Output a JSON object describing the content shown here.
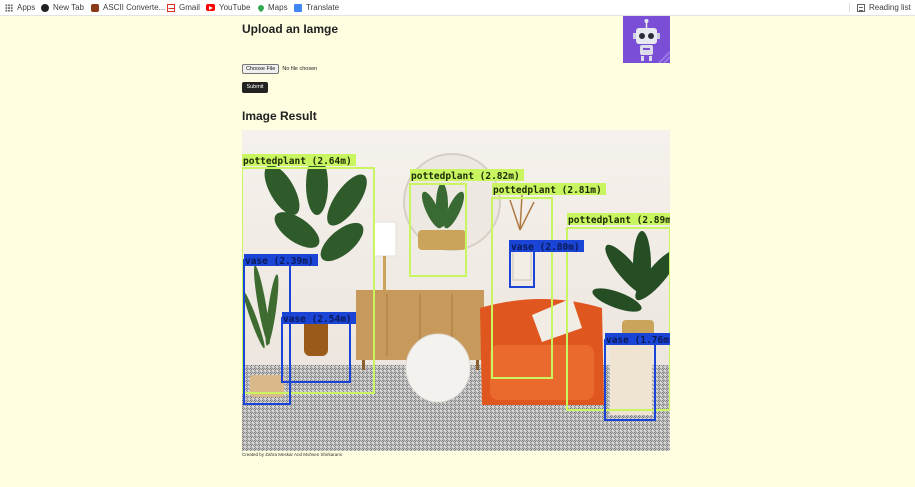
{
  "bookmarks_bar": {
    "items": [
      {
        "label": "Apps",
        "icon": "apps-grid-icon"
      },
      {
        "label": "New Tab",
        "icon": "new-tab-icon"
      },
      {
        "label": "ASCII Converte...",
        "icon": "ascii-icon"
      },
      {
        "label": "Gmail",
        "icon": "gmail-icon"
      },
      {
        "label": "YouTube",
        "icon": "youtube-icon"
      },
      {
        "label": "Maps",
        "icon": "maps-icon"
      },
      {
        "label": "Translate",
        "icon": "translate-icon"
      }
    ],
    "reading_list": {
      "label": "Reading list",
      "icon": "reading-list-icon"
    }
  },
  "upload": {
    "title": "Upload an Iamge",
    "choose_file_label": "Choose File",
    "file_status": "No file chosen",
    "submit_label": "Submit"
  },
  "result": {
    "title": "Image Result",
    "detections": [
      {
        "label": "pottedplant (2.64m)",
        "kind": "pottedplant"
      },
      {
        "label": "pottedplant (2.82m)",
        "kind": "pottedplant"
      },
      {
        "label": "pottedplant (2.81m)",
        "kind": "pottedplant"
      },
      {
        "label": "pottedplant (2.89m",
        "kind": "pottedplant"
      },
      {
        "label": "vase (2.39m)",
        "kind": "vase"
      },
      {
        "label": "vase (2.54m)",
        "kind": "vase"
      },
      {
        "label": "vase (2.80m)",
        "kind": "vase"
      },
      {
        "label": "vase (1.76m",
        "kind": "vase"
      }
    ]
  },
  "footer": {
    "credit": "Created by Zahra Meskar And Mohsen Shirkarami"
  },
  "colors": {
    "page_background": "#fffee0",
    "pottedplant_box": "#c8f560",
    "vase_box": "#1a44d6",
    "logo_background": "#7a4fd6"
  }
}
